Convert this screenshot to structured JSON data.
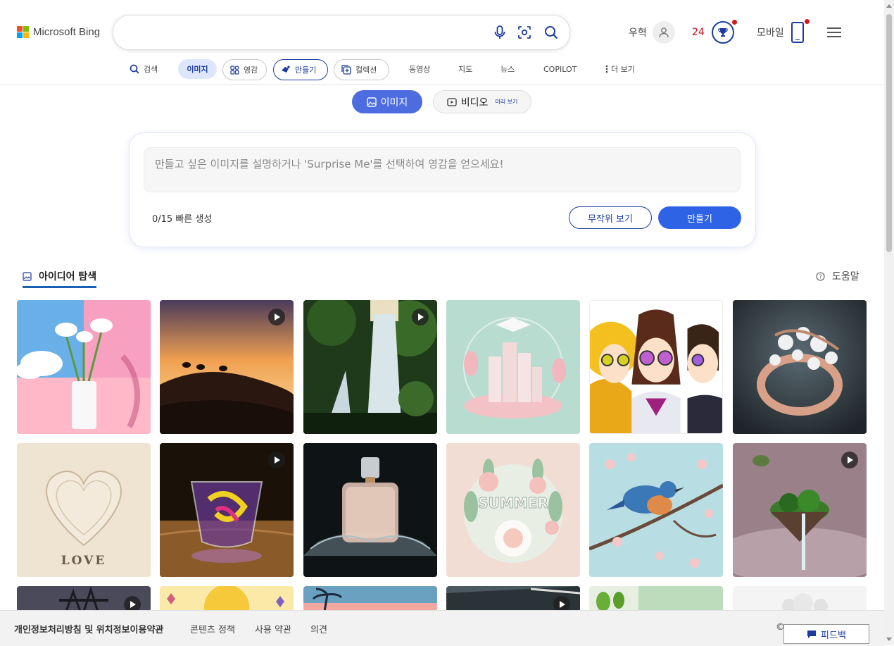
{
  "header": {
    "logo_text": "Microsoft Bing",
    "search_value": "",
    "user_name": "우혁",
    "points": "24",
    "mobile_label": "모바일"
  },
  "nav": {
    "tabs": [
      {
        "label": "검색",
        "icon": "search-icon"
      },
      {
        "label": "이미지",
        "active": true
      },
      {
        "label": "영감",
        "icon": "inspiration-icon"
      },
      {
        "label": "만들기",
        "icon": "create-icon"
      },
      {
        "label": "컬렉션",
        "icon": "collection-icon"
      },
      {
        "label": "동영상"
      },
      {
        "label": "지도"
      },
      {
        "label": "뉴스"
      },
      {
        "label": "COPILOT"
      },
      {
        "label": "더 보기",
        "icon": "more-vertical-icon"
      }
    ]
  },
  "mode": {
    "image_label": "이미지",
    "video_label": "비디오",
    "video_badge": "미리 보기"
  },
  "create": {
    "placeholder": "만들고 싶은 이미지를 설명하거나 'Surprise Me'를 선택하여 영감을 얻으세요!",
    "counter": "0/15 빠른 생성",
    "surprise_label": "무작위 보기",
    "create_label": "만들기"
  },
  "explore": {
    "title": "아이디어 탐색",
    "help_label": "도움말",
    "tiles": [
      {
        "name": "calla-lily-vase",
        "video": false
      },
      {
        "name": "desert-camel-sunset",
        "video": true
      },
      {
        "name": "forest-waterfall",
        "video": true
      },
      {
        "name": "pastel-graduation-city",
        "video": false
      },
      {
        "name": "anime-friends-sunglasses",
        "video": false
      },
      {
        "name": "pearl-ring",
        "video": false
      },
      {
        "name": "paper-heart-love",
        "video": false,
        "caption": "LOVE"
      },
      {
        "name": "rainbow-glass-bowl",
        "video": true
      },
      {
        "name": "perfume-bottle-splash",
        "video": false
      },
      {
        "name": "summer-paper-flowers",
        "video": false,
        "caption": "SUMMER"
      },
      {
        "name": "bird-cherry-blossom",
        "video": false
      },
      {
        "name": "floating-island",
        "video": true
      },
      {
        "name": "pirate-ship",
        "video": true
      },
      {
        "name": "sun-butterflies",
        "video": false
      },
      {
        "name": "tropical-beach",
        "video": false
      },
      {
        "name": "dark-car",
        "video": true
      },
      {
        "name": "green-leaves",
        "video": false
      },
      {
        "name": "white-clouds",
        "video": false
      }
    ]
  },
  "footer": {
    "links": [
      "개인정보처리방침 및 위치정보이용약관",
      "콘텐츠 정책",
      "사용 약관",
      "의견"
    ],
    "copyright": "©",
    "feedback_label": "피드백"
  },
  "colors": {
    "accent": "#2f63e6",
    "nav_active_bg": "#dde6fb",
    "brand_blue": "#1a3c9e",
    "points_red": "#c50f1f"
  }
}
